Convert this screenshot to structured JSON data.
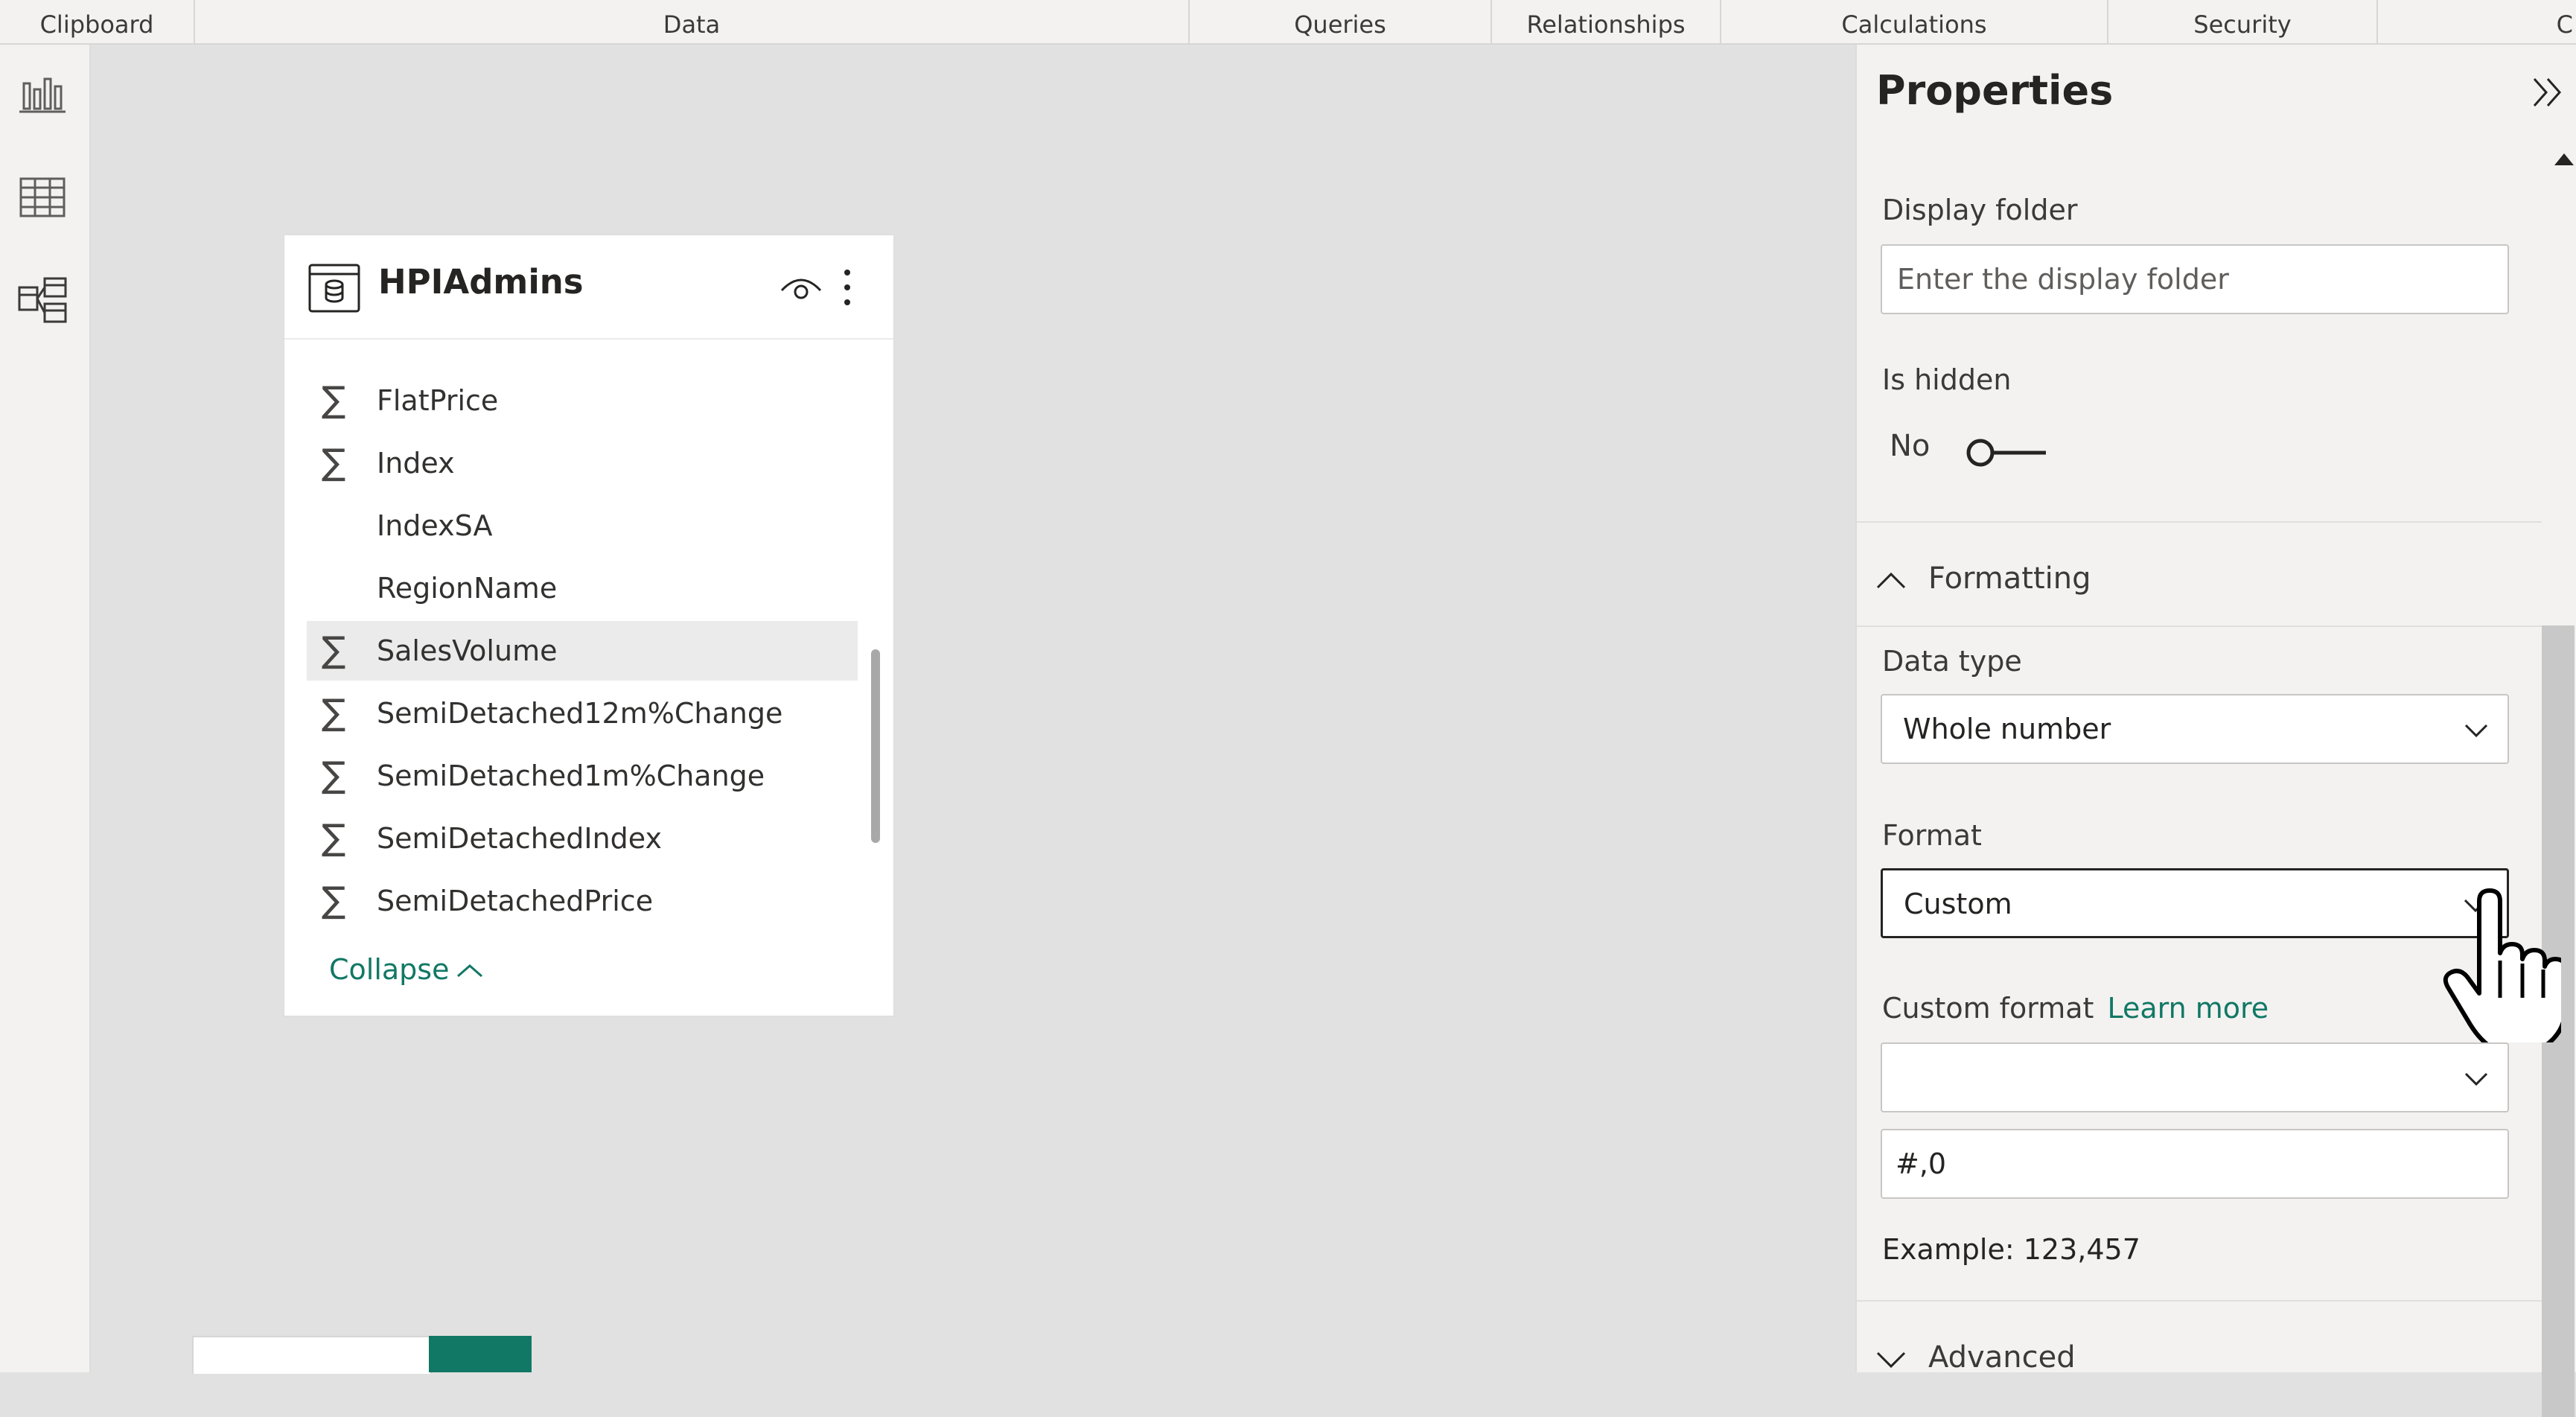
{
  "ribbon": {
    "groups": [
      "Clipboard",
      "Data",
      "Queries",
      "Relationships",
      "Calculations",
      "Security",
      "C"
    ]
  },
  "rail": {
    "icons": [
      "report-view-icon",
      "table-view-icon",
      "model-view-icon"
    ]
  },
  "table_card": {
    "title": "HPIAdmins",
    "fields": [
      {
        "name": "FlatPrice",
        "summed": true
      },
      {
        "name": "Index",
        "summed": true
      },
      {
        "name": "IndexSA",
        "summed": false
      },
      {
        "name": "RegionName",
        "summed": false
      },
      {
        "name": "SalesVolume",
        "summed": true,
        "selected": true
      },
      {
        "name": "SemiDetached12m%Change",
        "summed": true
      },
      {
        "name": "SemiDetached1m%Change",
        "summed": true
      },
      {
        "name": "SemiDetachedIndex",
        "summed": true
      },
      {
        "name": "SemiDetachedPrice",
        "summed": true
      }
    ],
    "collapse_label": "Collapse"
  },
  "properties": {
    "title": "Properties",
    "display_folder_label": "Display folder",
    "display_folder_placeholder": "Enter the display folder",
    "is_hidden_label": "Is hidden",
    "is_hidden_value": "No",
    "formatting_label": "Formatting",
    "data_type_label": "Data type",
    "data_type_value": "Whole number",
    "format_label": "Format",
    "format_value": "Custom",
    "custom_format_label": "Custom format",
    "learn_more_label": "Learn more",
    "custom_format_select_value": "",
    "custom_format_input_value": "#,0",
    "example_text": "Example: 123,457",
    "advanced_label": "Advanced"
  },
  "colors": {
    "accent": "#117865",
    "panel_bg": "#f3f2f1",
    "canvas_bg": "#e1e1e1"
  }
}
